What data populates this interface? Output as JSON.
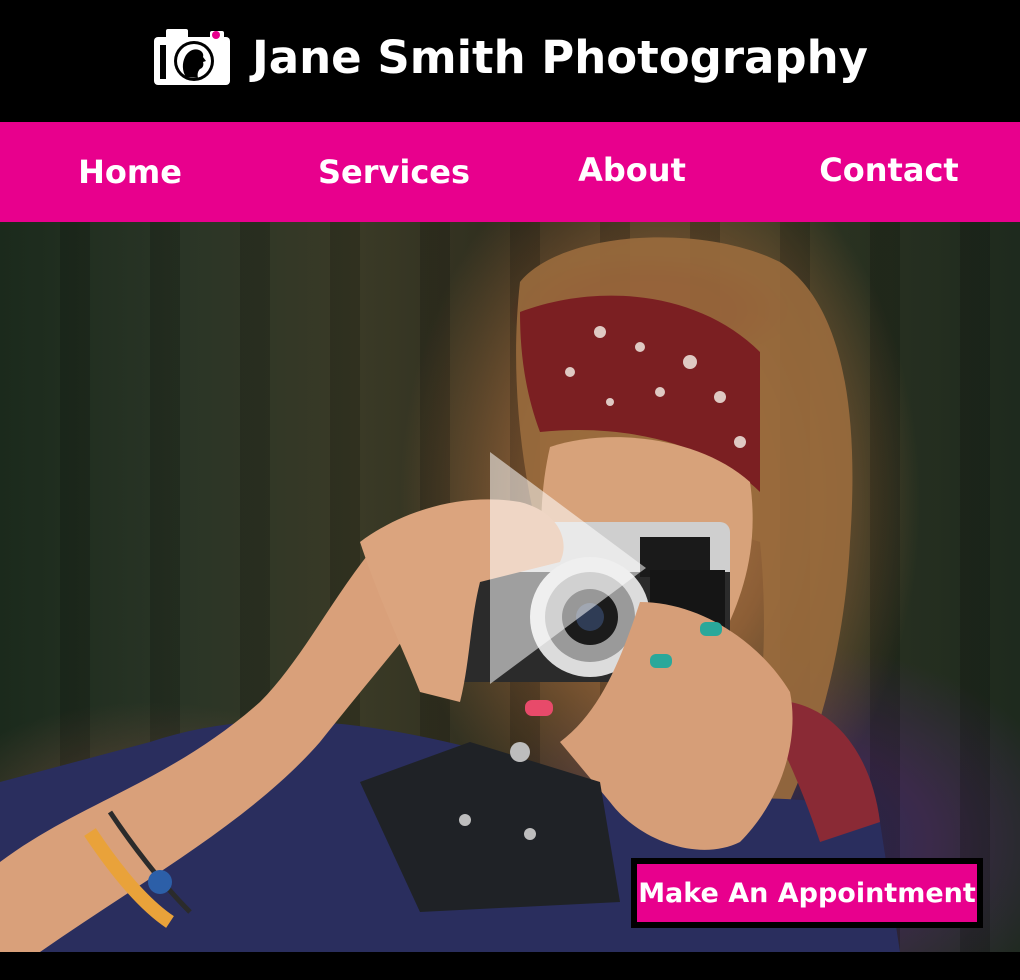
{
  "header": {
    "title": "Jane Smith Photography",
    "logo_icon": "camera-silhouette-icon"
  },
  "nav": {
    "items": [
      {
        "label": "Home"
      },
      {
        "label": "Services"
      },
      {
        "label": "About"
      },
      {
        "label": "Contact"
      }
    ]
  },
  "hero": {
    "image": "woman-with-camera-photo",
    "play_icon": "play-icon",
    "cta_label": "Make An Appointment"
  },
  "colors": {
    "brand_pink": "#e8008d",
    "header_bg": "#000000",
    "text": "#ffffff"
  }
}
